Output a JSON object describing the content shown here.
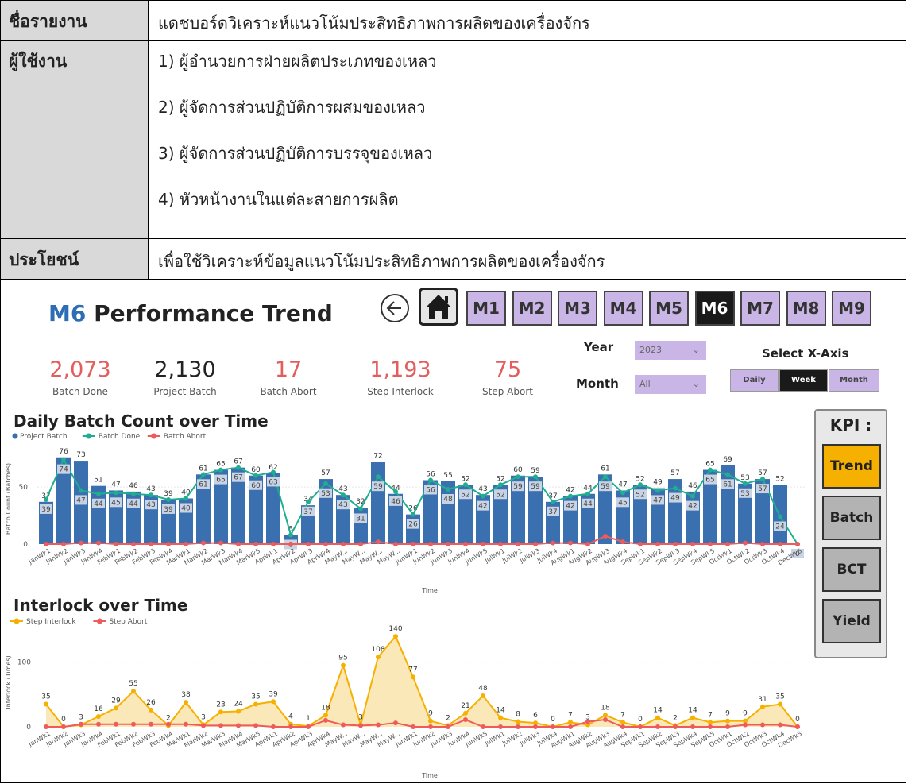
{
  "table": {
    "report_label": "ชื่อรายงาน",
    "report_value": "แดชบอร์ดวิเคราะห์แนวโน้มประสิทธิภาพการผลิตของเครื่องจักร",
    "users_label": "ผู้ใช้งาน",
    "users": [
      "1) ผู้อำนวยการฝ่ายผลิตประเภทของเหลว",
      "2) ผู้จัดการส่วนปฏิบัติการผสมของเหลว",
      "3) ผู้จัดการส่วนปฏิบัติการบรรจุของเหลว",
      "4) หัวหน้างานในแต่ละสายการผลิต"
    ],
    "benefit_label": "ประโยชน์",
    "benefit_value": "เพื่อใช้วิเคราะห์ข้อมูลแนวโน้มประสิทธิภาพการผลิตของเครื่องจักร"
  },
  "dashboard": {
    "title_machine": "M6",
    "title_rest": "Performance Trend",
    "machines": [
      "M1",
      "M2",
      "M3",
      "M4",
      "M5",
      "M6",
      "M7",
      "M8",
      "M9"
    ],
    "active_machine": "M6",
    "kpis": [
      {
        "value": "2,073",
        "label": "Batch Done",
        "color": "#e35d5d"
      },
      {
        "value": "2,130",
        "label": "Project Batch",
        "color": "#222222"
      },
      {
        "value": "17",
        "label": "Batch Abort",
        "color": "#e35d5d"
      },
      {
        "value": "1,193",
        "label": "Step Interlock",
        "color": "#e35d5d"
      },
      {
        "value": "75",
        "label": "Step Abort",
        "color": "#e35d5d"
      }
    ],
    "year_label": "Year",
    "year_value": "2023",
    "month_label": "Month",
    "month_value": "All",
    "xaxis_label": "Select X-Axis",
    "xaxis_options": [
      "Daily",
      "Week",
      "Month"
    ],
    "xaxis_active": "Week",
    "kpi_panel_title": "KPI :",
    "kpi_panel_buttons": [
      "Trend",
      "Batch",
      "BCT",
      "Yield"
    ],
    "kpi_panel_active": "Trend",
    "back_icon": "back-arrow-icon",
    "home_icon": "home-icon"
  },
  "chart_data": [
    {
      "type": "bar",
      "title": "Daily Batch Count over Time",
      "xlabel": "Time",
      "ylabel": "Batch Count (Batches)",
      "ylim": [
        0,
        80
      ],
      "yticks": [
        0,
        50
      ],
      "legend_position": "top-left",
      "categories": [
        "JanWk1",
        "JanWk2",
        "JanWk3",
        "JanWk4",
        "FebWk1",
        "FebWk2",
        "FebWk3",
        "FebWk4",
        "MarWk1",
        "MarWk2",
        "MarWk3",
        "MarWk4",
        "MarWk5",
        "AprWk1",
        "AprWk2",
        "AprWk3",
        "AprWk4",
        "MayW...",
        "MayW...",
        "MayW...",
        "MayW...",
        "JunWk1",
        "JunWk2",
        "JunWk3",
        "JunWk4",
        "JunWk5",
        "JulWk1",
        "JulWk2",
        "JulWk3",
        "JulWk4",
        "AugWk1",
        "AugWk2",
        "AugWk3",
        "AugWk4",
        "SepWk1",
        "SepWk2",
        "SepWk3",
        "SepWk4",
        "SepWk5",
        "OctWk1",
        "OctWk2",
        "OctWk3",
        "OctWk4",
        "DecWk5"
      ],
      "series": [
        {
          "name": "Project Batch",
          "type": "bar",
          "color": "#3a6fb0",
          "values": [
            37,
            76,
            73,
            51,
            47,
            46,
            43,
            39,
            40,
            61,
            65,
            67,
            60,
            62,
            8,
            34,
            57,
            43,
            32,
            72,
            44,
            26,
            56,
            55,
            52,
            43,
            52,
            60,
            59,
            37,
            42,
            44,
            61,
            47,
            52,
            49,
            57,
            46,
            65,
            69,
            53,
            57,
            52,
            0
          ]
        },
        {
          "name": "Batch Done",
          "type": "line",
          "color": "#1fae8f",
          "values": [
            39,
            74,
            47,
            44,
            45,
            44,
            43,
            39,
            40,
            61,
            65,
            67,
            60,
            63,
            8,
            37,
            53,
            43,
            31,
            59,
            46,
            26,
            56,
            48,
            52,
            42,
            52,
            59,
            59,
            37,
            42,
            44,
            59,
            45,
            52,
            47,
            49,
            42,
            65,
            61,
            53,
            57,
            24,
            0
          ]
        },
        {
          "name": "Batch Abort",
          "type": "line",
          "color": "#ef5b5b",
          "values": [
            0,
            0,
            1,
            1,
            0,
            0,
            0,
            0,
            0,
            1,
            1,
            0,
            0,
            0,
            0,
            0,
            0,
            0,
            0,
            2,
            0,
            0,
            0,
            0,
            0,
            0,
            0,
            0,
            0,
            1,
            1,
            0,
            7,
            2,
            0,
            0,
            0,
            0,
            0,
            0,
            1,
            0,
            0,
            0
          ]
        }
      ]
    },
    {
      "type": "area",
      "title": "Interlock over Time",
      "xlabel": "Time",
      "ylabel": "Interlock (Times)",
      "ylim": [
        0,
        145
      ],
      "yticks": [
        0,
        100
      ],
      "legend_position": "top-left",
      "categories": [
        "JanWk1",
        "JanWk2",
        "JanWk3",
        "JanWk4",
        "FebWk1",
        "FebWk2",
        "FebWk3",
        "FebWk4",
        "MarWk1",
        "MarWk2",
        "MarWk3",
        "MarWk4",
        "MarWk5",
        "AprWk1",
        "AprWk2",
        "AprWk3",
        "AprWk4",
        "MayW...",
        "MayW...",
        "MayW...",
        "MayW...",
        "JunWk1",
        "JunWk2",
        "JunWk3",
        "JunWk4",
        "JunWk5",
        "JulWk1",
        "JulWk2",
        "JulWk3",
        "JulWk4",
        "AugWk1",
        "AugWk2",
        "AugWk3",
        "AugWk4",
        "SepWk1",
        "SepWk2",
        "SepWk3",
        "SepWk4",
        "SepWk5",
        "OctWk1",
        "OctWk2",
        "OctWk3",
        "OctWk4",
        "DecWk5"
      ],
      "series": [
        {
          "name": "Step Interlock",
          "color": "#f5b000",
          "values": [
            35,
            0,
            3,
            16,
            29,
            55,
            26,
            2,
            38,
            3,
            23,
            24,
            35,
            39,
            4,
            1,
            18,
            95,
            3,
            108,
            140,
            77,
            9,
            2,
            21,
            48,
            14,
            8,
            6,
            0,
            7,
            3,
            18,
            7,
            0,
            14,
            2,
            14,
            7,
            9,
            9,
            31,
            35,
            0
          ]
        },
        {
          "name": "Step Abort",
          "color": "#ef5b5b",
          "values": [
            0,
            0,
            4,
            4,
            4,
            4,
            4,
            4,
            4,
            2,
            2,
            2,
            2,
            0,
            0,
            0,
            10,
            3,
            2,
            3,
            6,
            0,
            0,
            0,
            11,
            0,
            0,
            0,
            0,
            0,
            0,
            8,
            11,
            0,
            0,
            0,
            0,
            0,
            0,
            0,
            3,
            3,
            3,
            0
          ]
        }
      ]
    }
  ]
}
